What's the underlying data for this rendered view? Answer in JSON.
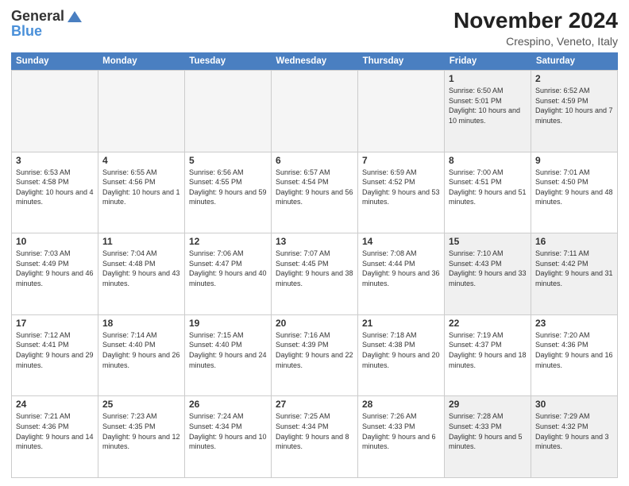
{
  "header": {
    "logo_general": "General",
    "logo_blue": "Blue",
    "month_title": "November 2024",
    "location": "Crespino, Veneto, Italy"
  },
  "calendar": {
    "days_of_week": [
      "Sunday",
      "Monday",
      "Tuesday",
      "Wednesday",
      "Thursday",
      "Friday",
      "Saturday"
    ],
    "rows": [
      [
        {
          "day": "",
          "empty": true
        },
        {
          "day": "",
          "empty": true
        },
        {
          "day": "",
          "empty": true
        },
        {
          "day": "",
          "empty": true
        },
        {
          "day": "",
          "empty": true
        },
        {
          "day": "1",
          "sunrise": "Sunrise: 6:50 AM",
          "sunset": "Sunset: 5:01 PM",
          "daylight": "Daylight: 10 hours and 10 minutes."
        },
        {
          "day": "2",
          "sunrise": "Sunrise: 6:52 AM",
          "sunset": "Sunset: 4:59 PM",
          "daylight": "Daylight: 10 hours and 7 minutes."
        }
      ],
      [
        {
          "day": "3",
          "sunrise": "Sunrise: 6:53 AM",
          "sunset": "Sunset: 4:58 PM",
          "daylight": "Daylight: 10 hours and 4 minutes."
        },
        {
          "day": "4",
          "sunrise": "Sunrise: 6:55 AM",
          "sunset": "Sunset: 4:56 PM",
          "daylight": "Daylight: 10 hours and 1 minute."
        },
        {
          "day": "5",
          "sunrise": "Sunrise: 6:56 AM",
          "sunset": "Sunset: 4:55 PM",
          "daylight": "Daylight: 9 hours and 59 minutes."
        },
        {
          "day": "6",
          "sunrise": "Sunrise: 6:57 AM",
          "sunset": "Sunset: 4:54 PM",
          "daylight": "Daylight: 9 hours and 56 minutes."
        },
        {
          "day": "7",
          "sunrise": "Sunrise: 6:59 AM",
          "sunset": "Sunset: 4:52 PM",
          "daylight": "Daylight: 9 hours and 53 minutes."
        },
        {
          "day": "8",
          "sunrise": "Sunrise: 7:00 AM",
          "sunset": "Sunset: 4:51 PM",
          "daylight": "Daylight: 9 hours and 51 minutes."
        },
        {
          "day": "9",
          "sunrise": "Sunrise: 7:01 AM",
          "sunset": "Sunset: 4:50 PM",
          "daylight": "Daylight: 9 hours and 48 minutes."
        }
      ],
      [
        {
          "day": "10",
          "sunrise": "Sunrise: 7:03 AM",
          "sunset": "Sunset: 4:49 PM",
          "daylight": "Daylight: 9 hours and 46 minutes."
        },
        {
          "day": "11",
          "sunrise": "Sunrise: 7:04 AM",
          "sunset": "Sunset: 4:48 PM",
          "daylight": "Daylight: 9 hours and 43 minutes."
        },
        {
          "day": "12",
          "sunrise": "Sunrise: 7:06 AM",
          "sunset": "Sunset: 4:47 PM",
          "daylight": "Daylight: 9 hours and 40 minutes."
        },
        {
          "day": "13",
          "sunrise": "Sunrise: 7:07 AM",
          "sunset": "Sunset: 4:45 PM",
          "daylight": "Daylight: 9 hours and 38 minutes."
        },
        {
          "day": "14",
          "sunrise": "Sunrise: 7:08 AM",
          "sunset": "Sunset: 4:44 PM",
          "daylight": "Daylight: 9 hours and 36 minutes."
        },
        {
          "day": "15",
          "sunrise": "Sunrise: 7:10 AM",
          "sunset": "Sunset: 4:43 PM",
          "daylight": "Daylight: 9 hours and 33 minutes."
        },
        {
          "day": "16",
          "sunrise": "Sunrise: 7:11 AM",
          "sunset": "Sunset: 4:42 PM",
          "daylight": "Daylight: 9 hours and 31 minutes."
        }
      ],
      [
        {
          "day": "17",
          "sunrise": "Sunrise: 7:12 AM",
          "sunset": "Sunset: 4:41 PM",
          "daylight": "Daylight: 9 hours and 29 minutes."
        },
        {
          "day": "18",
          "sunrise": "Sunrise: 7:14 AM",
          "sunset": "Sunset: 4:40 PM",
          "daylight": "Daylight: 9 hours and 26 minutes."
        },
        {
          "day": "19",
          "sunrise": "Sunrise: 7:15 AM",
          "sunset": "Sunset: 4:40 PM",
          "daylight": "Daylight: 9 hours and 24 minutes."
        },
        {
          "day": "20",
          "sunrise": "Sunrise: 7:16 AM",
          "sunset": "Sunset: 4:39 PM",
          "daylight": "Daylight: 9 hours and 22 minutes."
        },
        {
          "day": "21",
          "sunrise": "Sunrise: 7:18 AM",
          "sunset": "Sunset: 4:38 PM",
          "daylight": "Daylight: 9 hours and 20 minutes."
        },
        {
          "day": "22",
          "sunrise": "Sunrise: 7:19 AM",
          "sunset": "Sunset: 4:37 PM",
          "daylight": "Daylight: 9 hours and 18 minutes."
        },
        {
          "day": "23",
          "sunrise": "Sunrise: 7:20 AM",
          "sunset": "Sunset: 4:36 PM",
          "daylight": "Daylight: 9 hours and 16 minutes."
        }
      ],
      [
        {
          "day": "24",
          "sunrise": "Sunrise: 7:21 AM",
          "sunset": "Sunset: 4:36 PM",
          "daylight": "Daylight: 9 hours and 14 minutes."
        },
        {
          "day": "25",
          "sunrise": "Sunrise: 7:23 AM",
          "sunset": "Sunset: 4:35 PM",
          "daylight": "Daylight: 9 hours and 12 minutes."
        },
        {
          "day": "26",
          "sunrise": "Sunrise: 7:24 AM",
          "sunset": "Sunset: 4:34 PM",
          "daylight": "Daylight: 9 hours and 10 minutes."
        },
        {
          "day": "27",
          "sunrise": "Sunrise: 7:25 AM",
          "sunset": "Sunset: 4:34 PM",
          "daylight": "Daylight: 9 hours and 8 minutes."
        },
        {
          "day": "28",
          "sunrise": "Sunrise: 7:26 AM",
          "sunset": "Sunset: 4:33 PM",
          "daylight": "Daylight: 9 hours and 6 minutes."
        },
        {
          "day": "29",
          "sunrise": "Sunrise: 7:28 AM",
          "sunset": "Sunset: 4:33 PM",
          "daylight": "Daylight: 9 hours and 5 minutes."
        },
        {
          "day": "30",
          "sunrise": "Sunrise: 7:29 AM",
          "sunset": "Sunset: 4:32 PM",
          "daylight": "Daylight: 9 hours and 3 minutes."
        }
      ]
    ]
  }
}
